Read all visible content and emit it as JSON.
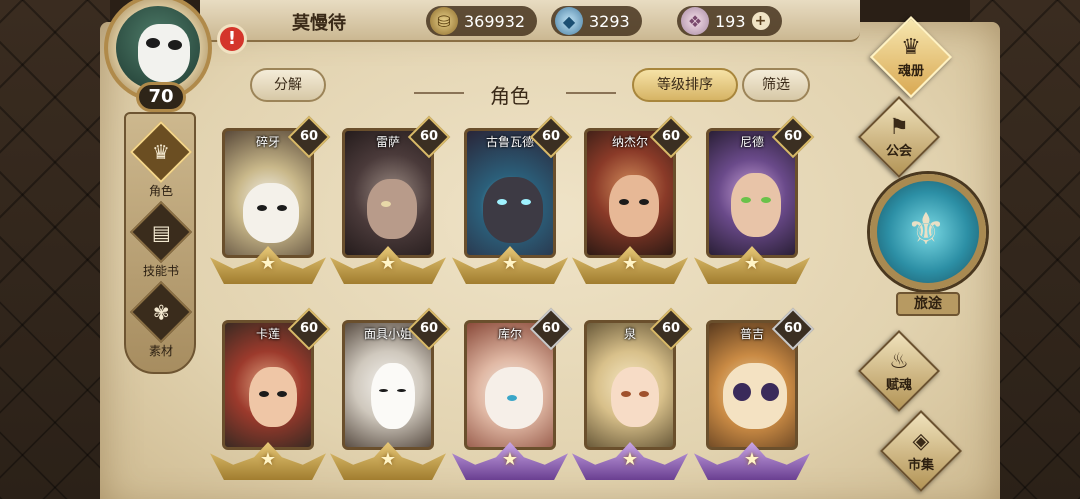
{
  "player": {
    "name": "莫慢待",
    "level": "70",
    "alert": "!"
  },
  "resources": {
    "gold": "369932",
    "crystal": "3293",
    "gem": "193",
    "plus": "+"
  },
  "left_nav": [
    {
      "label": "角色",
      "icon": "hero-icon",
      "active": true
    },
    {
      "label": "技能书",
      "icon": "skillbook-icon",
      "active": false
    },
    {
      "label": "素材",
      "icon": "material-icon",
      "active": false
    }
  ],
  "header": {
    "split_label": "分解",
    "title": "角色",
    "sort_label": "等级排序",
    "filter_label": "筛选"
  },
  "cards": [
    {
      "name": "碎牙",
      "level": "60",
      "frame": "gold"
    },
    {
      "name": "雷萨",
      "level": "60",
      "frame": "gold"
    },
    {
      "name": "古鲁瓦德",
      "level": "60",
      "frame": "gold"
    },
    {
      "name": "纳杰尔",
      "level": "60",
      "frame": "gold"
    },
    {
      "name": "尼德",
      "level": "60",
      "frame": "gold"
    },
    {
      "name": "卡莲",
      "level": "60",
      "frame": "gold"
    },
    {
      "name": "面具小姐",
      "level": "60",
      "frame": "gold"
    },
    {
      "name": "库尔",
      "level": "60",
      "frame": "purple"
    },
    {
      "name": "泉",
      "level": "60",
      "frame": "purple"
    },
    {
      "name": "普吉",
      "level": "60",
      "frame": "purple"
    }
  ],
  "right_nav": {
    "soulbook": "魂册",
    "guild": "公会",
    "journey": "旅途",
    "soul": "赋魂",
    "market": "市集"
  },
  "colors": {
    "parchment": "#e2d3b0",
    "gold_frame": "#d8b968",
    "purple_frame": "#6a3f91",
    "journey_orb": "#2c8fa5"
  }
}
